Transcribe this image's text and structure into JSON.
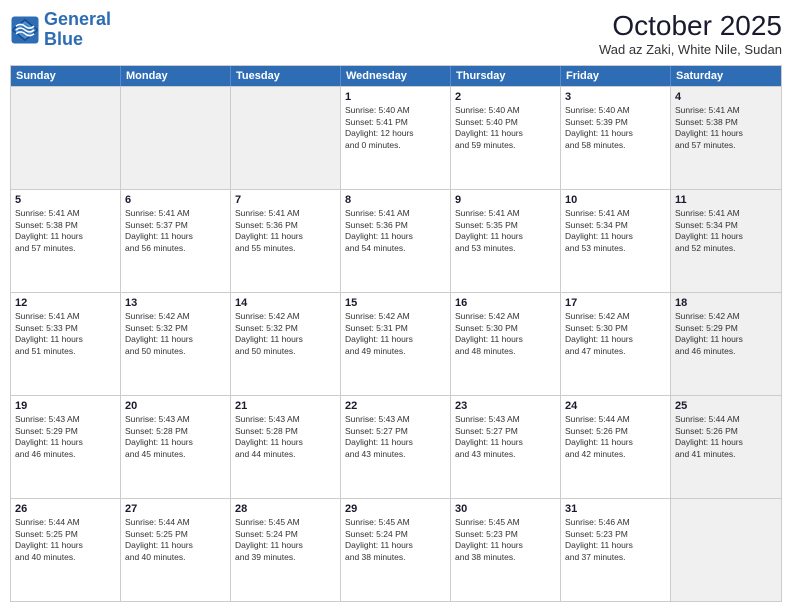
{
  "header": {
    "logo_line1": "General",
    "logo_line2": "Blue",
    "month_title": "October 2025",
    "subtitle": "Wad az Zaki, White Nile, Sudan"
  },
  "days_of_week": [
    "Sunday",
    "Monday",
    "Tuesday",
    "Wednesday",
    "Thursday",
    "Friday",
    "Saturday"
  ],
  "weeks": [
    [
      {
        "day": "",
        "text": "",
        "shaded": true
      },
      {
        "day": "",
        "text": "",
        "shaded": true
      },
      {
        "day": "",
        "text": "",
        "shaded": true
      },
      {
        "day": "1",
        "text": "Sunrise: 5:40 AM\nSunset: 5:41 PM\nDaylight: 12 hours\nand 0 minutes."
      },
      {
        "day": "2",
        "text": "Sunrise: 5:40 AM\nSunset: 5:40 PM\nDaylight: 11 hours\nand 59 minutes."
      },
      {
        "day": "3",
        "text": "Sunrise: 5:40 AM\nSunset: 5:39 PM\nDaylight: 11 hours\nand 58 minutes."
      },
      {
        "day": "4",
        "text": "Sunrise: 5:41 AM\nSunset: 5:38 PM\nDaylight: 11 hours\nand 57 minutes.",
        "shaded": true
      }
    ],
    [
      {
        "day": "5",
        "text": "Sunrise: 5:41 AM\nSunset: 5:38 PM\nDaylight: 11 hours\nand 57 minutes."
      },
      {
        "day": "6",
        "text": "Sunrise: 5:41 AM\nSunset: 5:37 PM\nDaylight: 11 hours\nand 56 minutes."
      },
      {
        "day": "7",
        "text": "Sunrise: 5:41 AM\nSunset: 5:36 PM\nDaylight: 11 hours\nand 55 minutes."
      },
      {
        "day": "8",
        "text": "Sunrise: 5:41 AM\nSunset: 5:36 PM\nDaylight: 11 hours\nand 54 minutes."
      },
      {
        "day": "9",
        "text": "Sunrise: 5:41 AM\nSunset: 5:35 PM\nDaylight: 11 hours\nand 53 minutes."
      },
      {
        "day": "10",
        "text": "Sunrise: 5:41 AM\nSunset: 5:34 PM\nDaylight: 11 hours\nand 53 minutes."
      },
      {
        "day": "11",
        "text": "Sunrise: 5:41 AM\nSunset: 5:34 PM\nDaylight: 11 hours\nand 52 minutes.",
        "shaded": true
      }
    ],
    [
      {
        "day": "12",
        "text": "Sunrise: 5:41 AM\nSunset: 5:33 PM\nDaylight: 11 hours\nand 51 minutes."
      },
      {
        "day": "13",
        "text": "Sunrise: 5:42 AM\nSunset: 5:32 PM\nDaylight: 11 hours\nand 50 minutes."
      },
      {
        "day": "14",
        "text": "Sunrise: 5:42 AM\nSunset: 5:32 PM\nDaylight: 11 hours\nand 50 minutes."
      },
      {
        "day": "15",
        "text": "Sunrise: 5:42 AM\nSunset: 5:31 PM\nDaylight: 11 hours\nand 49 minutes."
      },
      {
        "day": "16",
        "text": "Sunrise: 5:42 AM\nSunset: 5:30 PM\nDaylight: 11 hours\nand 48 minutes."
      },
      {
        "day": "17",
        "text": "Sunrise: 5:42 AM\nSunset: 5:30 PM\nDaylight: 11 hours\nand 47 minutes."
      },
      {
        "day": "18",
        "text": "Sunrise: 5:42 AM\nSunset: 5:29 PM\nDaylight: 11 hours\nand 46 minutes.",
        "shaded": true
      }
    ],
    [
      {
        "day": "19",
        "text": "Sunrise: 5:43 AM\nSunset: 5:29 PM\nDaylight: 11 hours\nand 46 minutes."
      },
      {
        "day": "20",
        "text": "Sunrise: 5:43 AM\nSunset: 5:28 PM\nDaylight: 11 hours\nand 45 minutes."
      },
      {
        "day": "21",
        "text": "Sunrise: 5:43 AM\nSunset: 5:28 PM\nDaylight: 11 hours\nand 44 minutes."
      },
      {
        "day": "22",
        "text": "Sunrise: 5:43 AM\nSunset: 5:27 PM\nDaylight: 11 hours\nand 43 minutes."
      },
      {
        "day": "23",
        "text": "Sunrise: 5:43 AM\nSunset: 5:27 PM\nDaylight: 11 hours\nand 43 minutes."
      },
      {
        "day": "24",
        "text": "Sunrise: 5:44 AM\nSunset: 5:26 PM\nDaylight: 11 hours\nand 42 minutes."
      },
      {
        "day": "25",
        "text": "Sunrise: 5:44 AM\nSunset: 5:26 PM\nDaylight: 11 hours\nand 41 minutes.",
        "shaded": true
      }
    ],
    [
      {
        "day": "26",
        "text": "Sunrise: 5:44 AM\nSunset: 5:25 PM\nDaylight: 11 hours\nand 40 minutes."
      },
      {
        "day": "27",
        "text": "Sunrise: 5:44 AM\nSunset: 5:25 PM\nDaylight: 11 hours\nand 40 minutes."
      },
      {
        "day": "28",
        "text": "Sunrise: 5:45 AM\nSunset: 5:24 PM\nDaylight: 11 hours\nand 39 minutes."
      },
      {
        "day": "29",
        "text": "Sunrise: 5:45 AM\nSunset: 5:24 PM\nDaylight: 11 hours\nand 38 minutes."
      },
      {
        "day": "30",
        "text": "Sunrise: 5:45 AM\nSunset: 5:23 PM\nDaylight: 11 hours\nand 38 minutes."
      },
      {
        "day": "31",
        "text": "Sunrise: 5:46 AM\nSunset: 5:23 PM\nDaylight: 11 hours\nand 37 minutes."
      },
      {
        "day": "",
        "text": "",
        "shaded": true
      }
    ]
  ]
}
